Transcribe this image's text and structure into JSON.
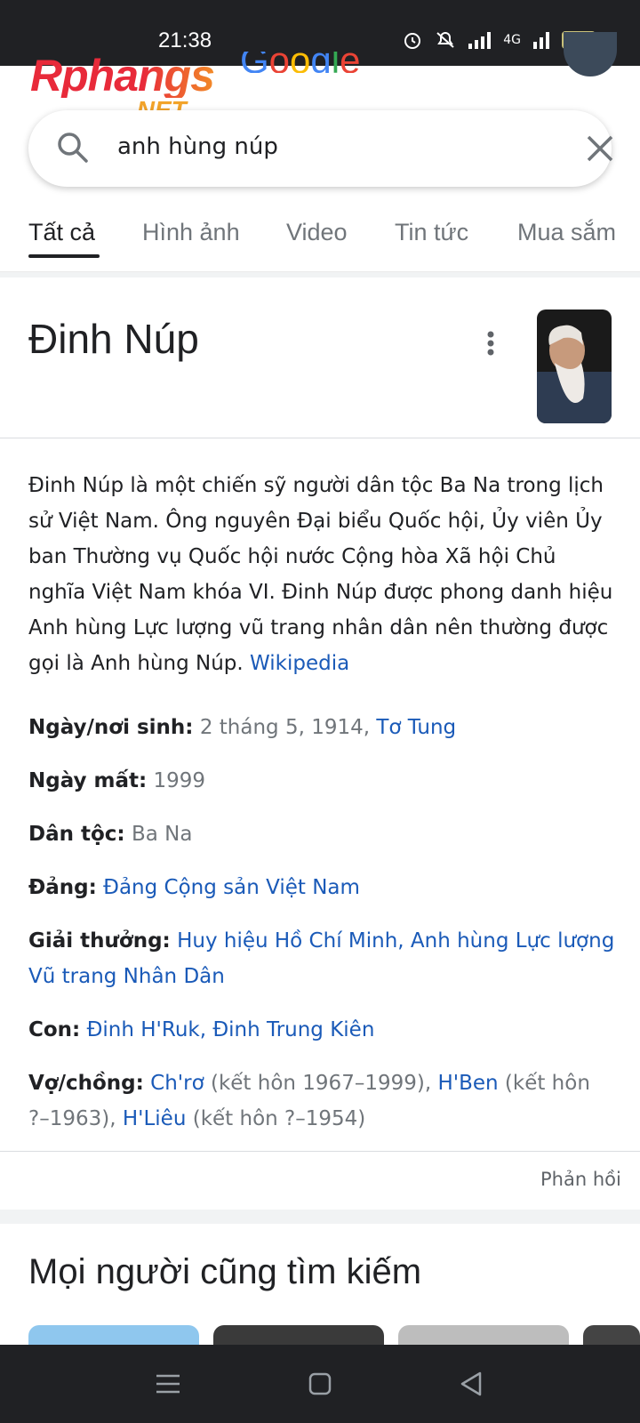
{
  "status_bar": {
    "time": "21:38",
    "battery": "89",
    "network": "4G"
  },
  "watermark": {
    "main": "Rphangs",
    "suffix": ".NET"
  },
  "search": {
    "query": "anh hùng núp"
  },
  "tabs": [
    {
      "label": "Tất cả",
      "active": true
    },
    {
      "label": "Hình ảnh"
    },
    {
      "label": "Video"
    },
    {
      "label": "Tin tức"
    },
    {
      "label": "Mua sắm"
    }
  ],
  "knowledge_panel": {
    "title": "Đinh Núp",
    "description": "Đinh Núp là một chiến sỹ người dân tộc Ba Na trong lịch sử Việt Nam. Ông nguyên Đại biểu Quốc hội, Ủy viên Ủy ban Thường vụ Quốc hội nước Cộng hòa Xã hội Chủ nghĩa Việt Nam khóa VI. Đinh Núp được phong danh hiệu Anh hùng Lực lượng vũ trang nhân dân nên thường được gọi là Anh hùng Núp.",
    "source": "Wikipedia",
    "facts": {
      "birth": {
        "label": "Ngày/nơi sinh:",
        "date": "2 tháng 5, 1914,",
        "place": "Tơ Tung"
      },
      "death": {
        "label": "Ngày mất:",
        "value": "1999"
      },
      "ethnicity": {
        "label": "Dân tộc:",
        "value": "Ba Na"
      },
      "party": {
        "label": "Đảng:",
        "value": "Đảng Cộng sản Việt Nam"
      },
      "awards": {
        "label": "Giải thưởng:",
        "value": "Huy hiệu Hồ Chí Minh, Anh hùng Lực lượng Vũ trang Nhân Dân"
      },
      "children": {
        "label": "Con:",
        "value": "Đinh H'Ruk, Đinh Trung Kiên"
      },
      "spouse": {
        "label": "Vợ/chồng:",
        "s1_name": "Ch'rơ",
        "s1_note": "(kết hôn 1967–1999),",
        "s2_name": "H'Ben",
        "s2_note": "(kết hôn ?–1963),",
        "s3_name": "H'Liêu",
        "s3_note": "(kết hôn ?–1954)"
      }
    },
    "feedback": "Phản hồi"
  },
  "people_also_search": {
    "title": "Mọi người cũng tìm kiếm"
  },
  "colors": {
    "link": "#1a5ab8",
    "text": "#202124",
    "muted": "#70757a"
  }
}
